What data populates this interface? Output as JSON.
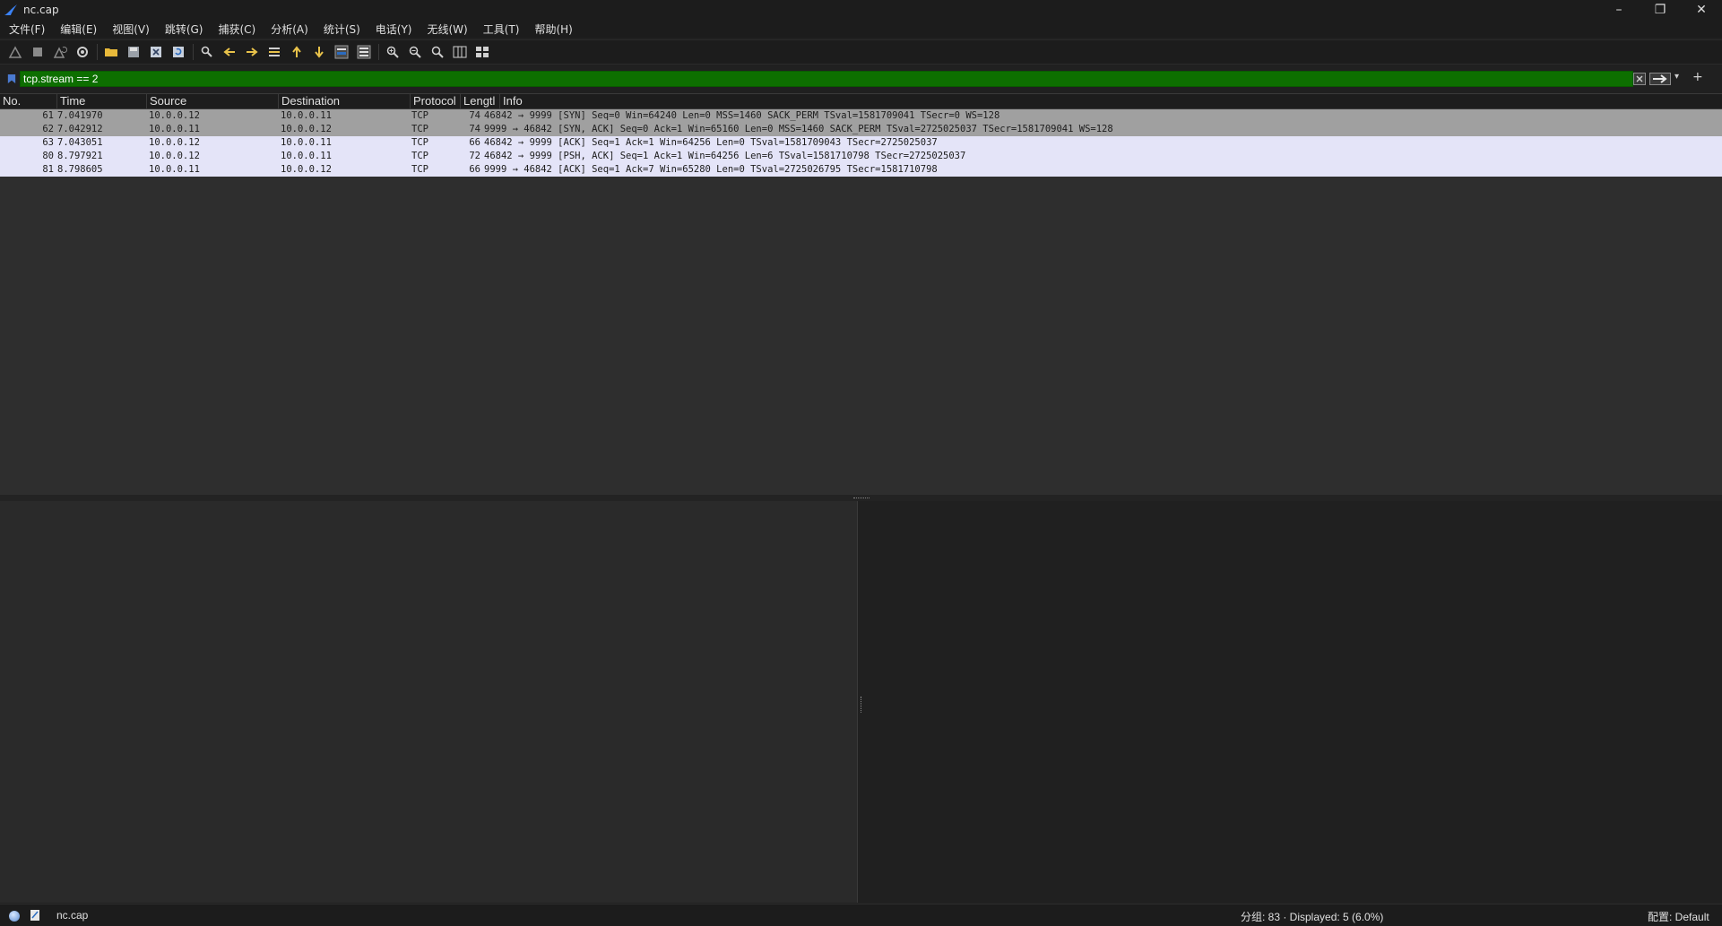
{
  "window": {
    "title": "nc.cap"
  },
  "menu": [
    {
      "label": "文件(F)"
    },
    {
      "label": "编辑(E)"
    },
    {
      "label": "视图(V)"
    },
    {
      "label": "跳转(G)"
    },
    {
      "label": "捕获(C)"
    },
    {
      "label": "分析(A)"
    },
    {
      "label": "统计(S)"
    },
    {
      "label": "电话(Y)"
    },
    {
      "label": "无线(W)"
    },
    {
      "label": "工具(T)"
    },
    {
      "label": "帮助(H)"
    }
  ],
  "filter": {
    "value": "tcp.stream == 2",
    "add_label": "+"
  },
  "packet_list": {
    "columns": [
      "No.",
      "Time",
      "Source",
      "Destination",
      "Protocol",
      "Length",
      "Info"
    ],
    "header_labels": {
      "no": "No.",
      "time": "Time",
      "source": "Source",
      "destination": "Destination",
      "protocol": "Protocol",
      "length": "Lengtl",
      "info": "Info"
    },
    "rows": [
      {
        "no": "61",
        "time": "7.041970",
        "source": "10.0.0.12",
        "destination": "10.0.0.11",
        "protocol": "TCP",
        "length": "74",
        "info": "46842 → 9999 [SYN] Seq=0 Win=64240 Len=0 MSS=1460 SACK_PERM TSval=1581709041 TSecr=0 WS=128"
      },
      {
        "no": "62",
        "time": "7.042912",
        "source": "10.0.0.11",
        "destination": "10.0.0.12",
        "protocol": "TCP",
        "length": "74",
        "info": "9999 → 46842 [SYN, ACK] Seq=0 Ack=1 Win=65160 Len=0 MSS=1460 SACK_PERM TSval=2725025037 TSecr=1581709041 WS=128"
      },
      {
        "no": "63",
        "time": "7.043051",
        "source": "10.0.0.12",
        "destination": "10.0.0.11",
        "protocol": "TCP",
        "length": "66",
        "info": "46842 → 9999 [ACK] Seq=1 Ack=1 Win=64256 Len=0 TSval=1581709043 TSecr=2725025037"
      },
      {
        "no": "80",
        "time": "8.797921",
        "source": "10.0.0.12",
        "destination": "10.0.0.11",
        "protocol": "TCP",
        "length": "72",
        "info": "46842 → 9999 [PSH, ACK] Seq=1 Ack=1 Win=64256 Len=6 TSval=1581710798 TSecr=2725025037"
      },
      {
        "no": "81",
        "time": "8.798605",
        "source": "10.0.0.11",
        "destination": "10.0.0.12",
        "protocol": "TCP",
        "length": "66",
        "info": "9999 → 46842 [ACK] Seq=1 Ack=7 Win=65280 Len=0 TSval=2725026795 TSecr=1581710798"
      }
    ],
    "row_colors": {
      "syn": "#a0a0a0",
      "tcp": "#e4e4f8"
    }
  },
  "status": {
    "file": "nc.cap",
    "packets": "分组: 83 · Displayed: 5 (6.0%)",
    "profile": "配置: Default"
  },
  "icons": {
    "toolbar": [
      "shark-fin-start-icon",
      "stop-icon",
      "restart-icon",
      "options-gear-icon",
      "open-folder-icon",
      "save-icon",
      "close-file-icon",
      "reload-icon",
      "find-icon",
      "go-back-icon",
      "go-forward-icon",
      "go-to-packet-icon",
      "first-packet-icon",
      "last-packet-icon",
      "autoscroll-icon",
      "colorize-icon",
      "zoom-in-icon",
      "zoom-out-icon",
      "zoom-normal-icon",
      "resize-columns-icon",
      "layout-icon"
    ]
  },
  "colors": {
    "filter_valid": "#0d6f00",
    "background": "#202020"
  }
}
